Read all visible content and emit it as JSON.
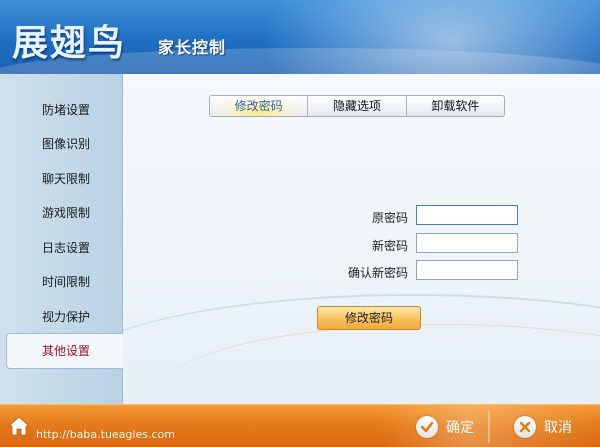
{
  "app": {
    "logo": "展翅鸟",
    "subtitle": "家长控制"
  },
  "sidebar": {
    "items": [
      {
        "label": "防堵设置"
      },
      {
        "label": "图像识别"
      },
      {
        "label": "聊天限制"
      },
      {
        "label": "游戏限制"
      },
      {
        "label": "日志设置"
      },
      {
        "label": "时间限制"
      },
      {
        "label": "视力保护"
      },
      {
        "label": "其他设置",
        "active": true
      }
    ]
  },
  "tabs": [
    {
      "label": "修改密码",
      "active": true
    },
    {
      "label": "隐藏选项"
    },
    {
      "label": "卸载软件"
    }
  ],
  "form": {
    "old_password": {
      "label": "原密码",
      "value": ""
    },
    "new_password": {
      "label": "新密码",
      "value": ""
    },
    "confirm_password": {
      "label": "确认新密码",
      "value": ""
    },
    "submit_label": "修改密码"
  },
  "footer": {
    "url": "http://baba.tueagles.com",
    "ok_label": "确定",
    "cancel_label": "取消"
  },
  "colors": {
    "header": "#1f6fc2",
    "footer": "#e57b1c",
    "active_nav_text": "#a0102a",
    "active_tab_text": "#2b63a8"
  }
}
